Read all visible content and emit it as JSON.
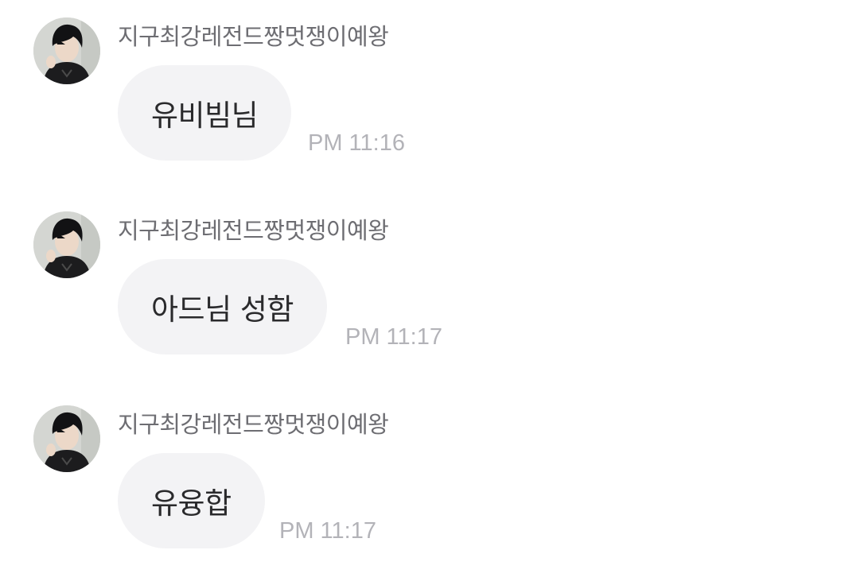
{
  "messages": [
    {
      "sender": "지구최강레전드짱멋쟁이예왕",
      "text": "유비빔님",
      "time": "PM 11:16"
    },
    {
      "sender": "지구최강레전드짱멋쟁이예왕",
      "text": "아드님 성함",
      "time": "PM 11:17"
    },
    {
      "sender": "지구최강레전드짱멋쟁이예왕",
      "text": "유융합",
      "time": "PM 11:17"
    }
  ],
  "icons": {
    "avatar": "profile-photo"
  },
  "colors": {
    "background": "#ffffff",
    "bubble": "#f3f3f5",
    "sender_name": "#6d6d72",
    "timestamp": "#b3b3b8",
    "message_text": "#2a2a2c"
  }
}
